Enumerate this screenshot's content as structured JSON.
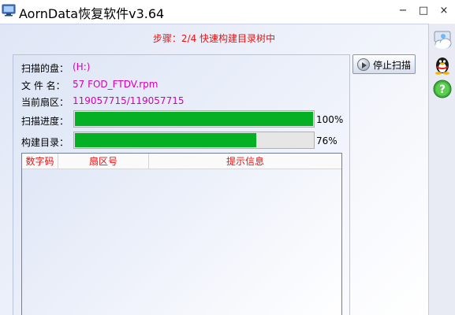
{
  "window": {
    "title": "AornData恢复软件v3.64",
    "minimize_glyph": "−",
    "maximize_glyph": "□",
    "close_glyph": "×"
  },
  "step": "步骤：2/4 快速构建目录树中",
  "scan": {
    "disk_label": "扫描的盘：",
    "disk_value": "(H:)",
    "file_label": "文 件 名：",
    "file_value": "57 FOD_FTDV.rpm",
    "sector_label": "当前扇区：",
    "sector_value": "119057715/119057715",
    "progress_label": "扫描进度：",
    "progress_percent": 100,
    "progress_text": "100%",
    "build_label": "构建目录：",
    "build_percent": 76,
    "build_text": "76%"
  },
  "table": {
    "columns": [
      "数字码",
      "扇区号",
      "提示信息"
    ],
    "rows": []
  },
  "buttons": {
    "stop_scan": "停止扫描"
  },
  "sidebar": {
    "icons": [
      "cloud-icon",
      "qq-icon",
      "help-icon"
    ]
  },
  "colors": {
    "progress_fill": "#06b025",
    "step_text": "#ee1111",
    "value_text": "#d400b4"
  }
}
